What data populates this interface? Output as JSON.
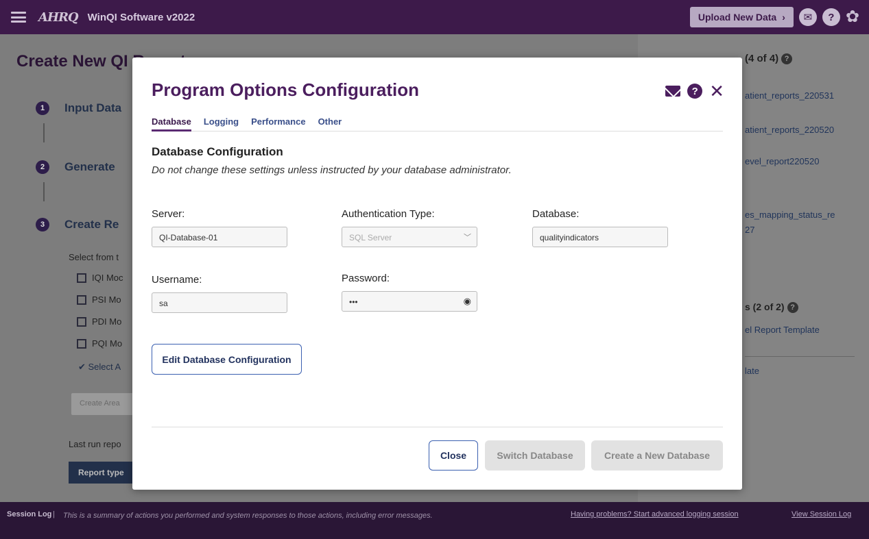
{
  "topbar": {
    "logo": "AHRQ",
    "app_title": "WinQI Software v2022",
    "upload_label": "Upload New Data",
    "upload_chevron": "›",
    "help_glyph": "?",
    "gear_glyph": "✿"
  },
  "page": {
    "title": "Create New QI Report",
    "steps": [
      {
        "num": "1",
        "label": "Input Data"
      },
      {
        "num": "2",
        "label": "Generate"
      },
      {
        "num": "3",
        "label": "Create Re"
      }
    ],
    "select_text": "Select from t",
    "modules": [
      "IQI Moc",
      "PSI Mo",
      "PDI Mo",
      "PQI Mo"
    ],
    "select_all": "✔ Select A",
    "create_area": "Create Area",
    "last_run": "Last run repo",
    "report_type": "Report type"
  },
  "side_panel": {
    "heading": "(4 of 4)",
    "reports": [
      "atient_reports_220531",
      "atient_reports_220520",
      "evel_report220520",
      "es_mapping_status_re",
      "27"
    ],
    "templates_heading": "s (2 of 2)",
    "templates": [
      "el Report Template",
      "late"
    ]
  },
  "footer": {
    "title": "Session Log",
    "separator": "|",
    "description": "This is a summary of actions you performed and system responses to those actions, including error messages.",
    "problem_link": "Having problems? Start advanced logging session",
    "view_link": "View Session Log"
  },
  "modal": {
    "title": "Program Options Configuration",
    "help_glyph": "?",
    "close_glyph": "✕",
    "tabs": [
      "Database",
      "Logging",
      "Performance",
      "Other"
    ],
    "section_title": "Database Configuration",
    "section_note": "Do not change these settings unless instructed by your database administrator.",
    "server_label": "Server:",
    "server_value": "QI-Database-01",
    "auth_label": "Authentication Type:",
    "auth_value": "SQL Server",
    "database_label": "Database:",
    "database_value": "qualityindicators",
    "username_label": "Username:",
    "username_value": "sa",
    "password_label": "Password:",
    "password_value": "•••",
    "edit_button": "Edit Database Configuration",
    "close_button": "Close",
    "switch_button": "Switch Database",
    "create_button": "Create a New Database"
  }
}
